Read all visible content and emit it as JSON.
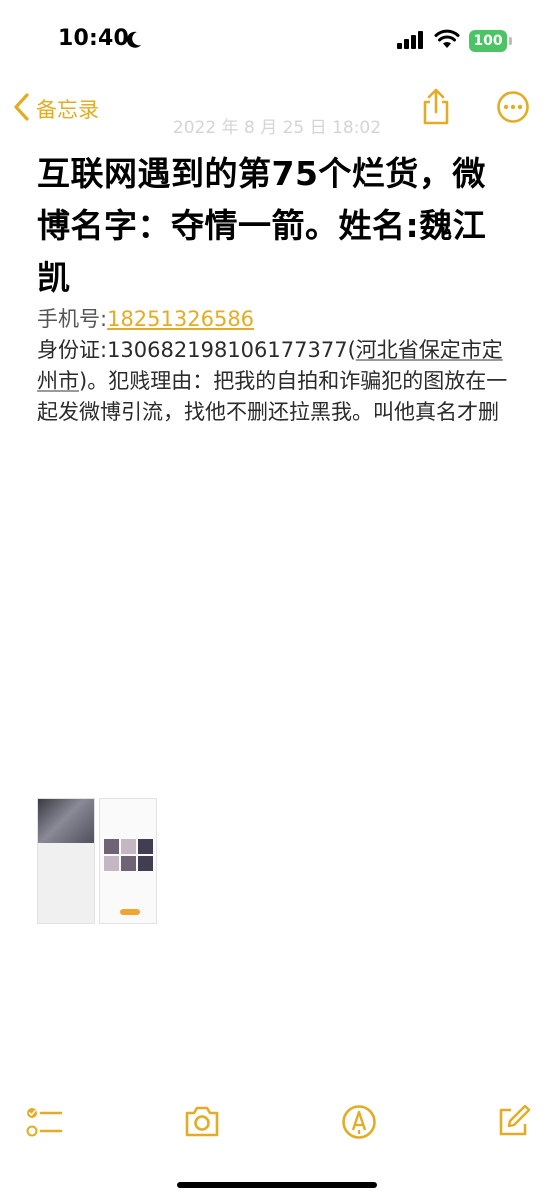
{
  "status_bar": {
    "time": "10:40",
    "battery": "100",
    "icons": [
      "moon-icon",
      "cellular-signal-icon",
      "wifi-icon",
      "battery-icon"
    ]
  },
  "nav": {
    "back_label": "备忘录",
    "icons": [
      "chevron-left-icon",
      "share-icon",
      "more-icon"
    ]
  },
  "note": {
    "date": "2022 年 8 月 25 日 18:02",
    "title": "互联网遇到的第75个烂货，微博名字：夺情一箭。姓名:魏江凯",
    "phone_label": "手机号:",
    "phone_number": "18251326586",
    "id_prefix": "身份证:130682198106177377(",
    "id_location": "河北省保定市定州市",
    "body_text": ")。犯贱理由：把我的自拍和诈骗犯的图放在一起发微博引流，找他不删还拉黑我。叫他真名才删",
    "attachment": "image-attachment"
  },
  "toolbar": {
    "icons": [
      "checklist-icon",
      "camera-icon",
      "markup-icon",
      "compose-icon"
    ]
  },
  "colors": {
    "accent": "#e2ad24",
    "battery": "#4cc466"
  }
}
